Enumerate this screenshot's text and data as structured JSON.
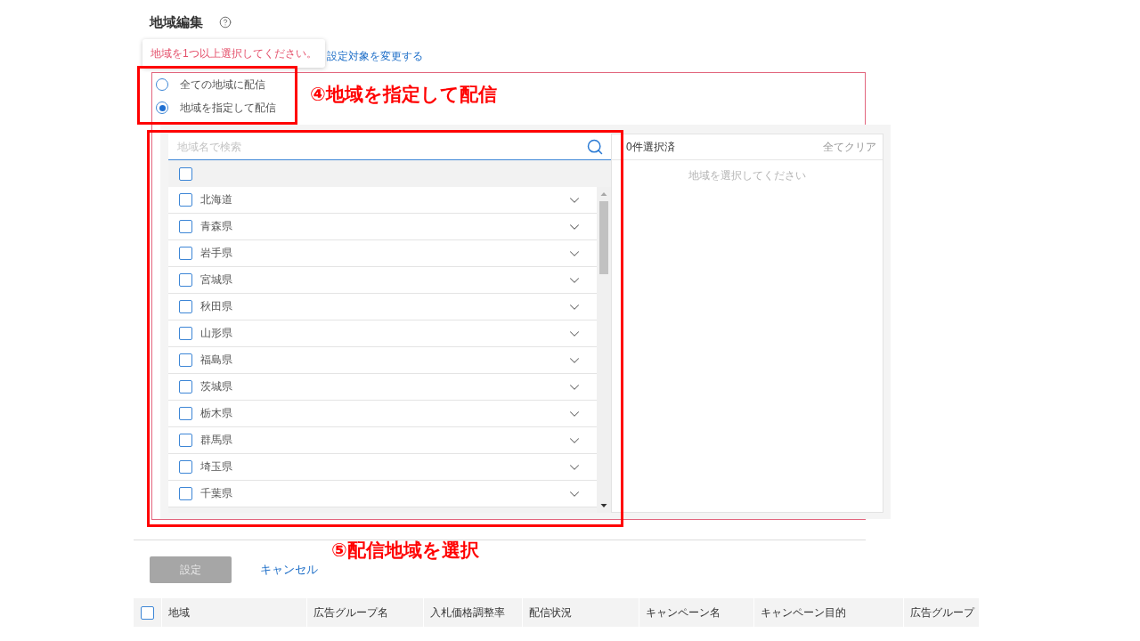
{
  "page": {
    "title": "地域編集"
  },
  "tooltip": {
    "message": "地域を1つ以上選択してください。"
  },
  "change_target_link": "設定対象を変更する",
  "delivery_options": [
    {
      "label": "全ての地域に配信",
      "selected": false
    },
    {
      "label": "地域を指定して配信",
      "selected": true
    }
  ],
  "region_picker": {
    "search": {
      "placeholder": "地域名で検索"
    },
    "select_all": {
      "checked": false
    },
    "regions": [
      {
        "name": "北海道",
        "checked": false,
        "expanded": false
      },
      {
        "name": "青森県",
        "checked": false,
        "expanded": false
      },
      {
        "name": "岩手県",
        "checked": false,
        "expanded": false
      },
      {
        "name": "宮城県",
        "checked": false,
        "expanded": false
      },
      {
        "name": "秋田県",
        "checked": false,
        "expanded": false
      },
      {
        "name": "山形県",
        "checked": false,
        "expanded": false
      },
      {
        "name": "福島県",
        "checked": false,
        "expanded": false
      },
      {
        "name": "茨城県",
        "checked": false,
        "expanded": false
      },
      {
        "name": "栃木県",
        "checked": false,
        "expanded": false
      },
      {
        "name": "群馬県",
        "checked": false,
        "expanded": false
      },
      {
        "name": "埼玉県",
        "checked": false,
        "expanded": false
      },
      {
        "name": "千葉県",
        "checked": false,
        "expanded": false
      }
    ],
    "selected_panel": {
      "count": "0件選択済",
      "clear_label": "全てクリア",
      "empty_message": "地域を選択してください"
    }
  },
  "annotations": [
    {
      "label": "④地域を指定して配信"
    },
    {
      "label": "⑤配信地域を選択"
    }
  ],
  "actions": {
    "submit": {
      "label": "設定",
      "disabled": true
    },
    "cancel": "キャンセル"
  },
  "table": {
    "select_all": {
      "checked": false
    },
    "columns": [
      "地域",
      "広告グループ名",
      "入札価格調整率",
      "配信状況",
      "キャンペーン名",
      "キャンペーン目的",
      "広告グループ"
    ]
  }
}
